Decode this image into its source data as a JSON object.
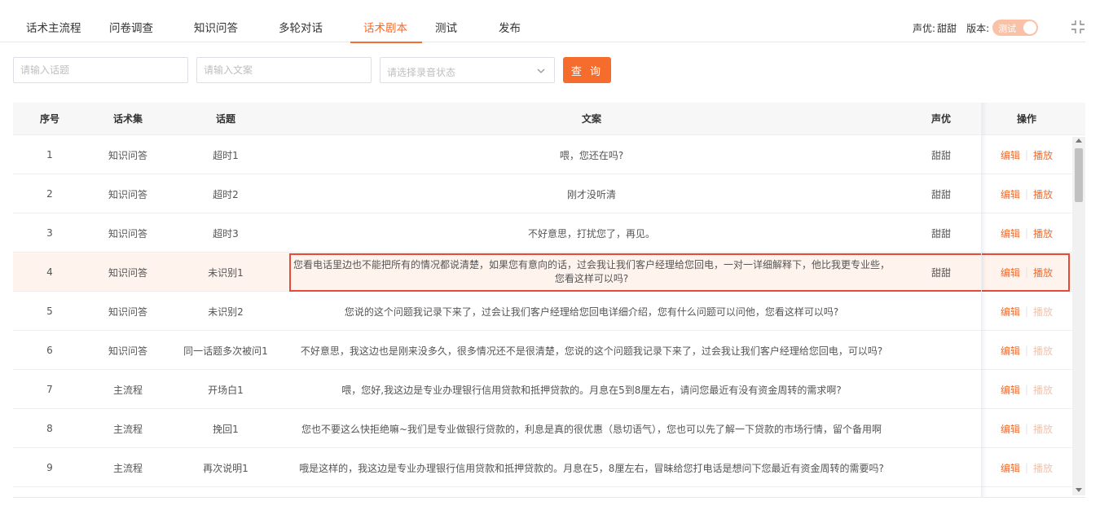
{
  "tabs": [
    {
      "label": "话术主流程",
      "active": false
    },
    {
      "label": "问卷调查",
      "active": false
    },
    {
      "label": "知识问答",
      "active": false
    },
    {
      "label": "多轮对话",
      "active": false
    },
    {
      "label": "话术剧本",
      "active": true
    },
    {
      "label": "测试",
      "active": false
    },
    {
      "label": "发布",
      "active": false
    }
  ],
  "header": {
    "voice_label": "声优:",
    "voice_value": "甜甜",
    "version_label": "版本:",
    "version_toggle": "测试"
  },
  "filters": {
    "topic_placeholder": "请输入话题",
    "text_placeholder": "请输入文案",
    "status_placeholder": "请选择录音状态",
    "query_label": "查 询"
  },
  "table": {
    "columns": [
      "序号",
      "话术集",
      "话题",
      "文案",
      "声优",
      "操作"
    ],
    "rows": [
      {
        "idx": "1",
        "set": "知识问答",
        "topic": "超时1",
        "text": "喂，您还在吗?",
        "voice": "甜甜",
        "play_enabled": true
      },
      {
        "idx": "2",
        "set": "知识问答",
        "topic": "超时2",
        "text": "刚才没听清",
        "voice": "甜甜",
        "play_enabled": true
      },
      {
        "idx": "3",
        "set": "知识问答",
        "topic": "超时3",
        "text": "不好意思，打扰您了，再见。",
        "voice": "甜甜",
        "play_enabled": true
      },
      {
        "idx": "4",
        "set": "知识问答",
        "topic": "未识别1",
        "text": "您看电话里边也不能把所有的情况都说清楚，如果您有意向的话，过会我让我们客户经理给您回电，一对一详细解释下，他比我更专业些，您看这样可以吗?",
        "voice": "甜甜",
        "play_enabled": true
      },
      {
        "idx": "5",
        "set": "知识问答",
        "topic": "未识别2",
        "text": "您说的这个问题我记录下来了，过会让我们客户经理给您回电详细介绍，您有什么问题可以问他，您看这样可以吗?",
        "voice": "",
        "play_enabled": false
      },
      {
        "idx": "6",
        "set": "知识问答",
        "topic": "同一话题多次被问1",
        "text": "不好意思，我这边也是刚来没多久，很多情况还不是很清楚，您说的这个问题我记录下来了，过会我让我们客户经理给您回电，可以吗?",
        "voice": "",
        "play_enabled": false
      },
      {
        "idx": "7",
        "set": "主流程",
        "topic": "开场白1",
        "text": "喂，您好,我这边是专业办理银行信用贷款和抵押贷款的。月息在5到8厘左右，请问您最近有没有资金周转的需求啊?",
        "voice": "",
        "play_enabled": false
      },
      {
        "idx": "8",
        "set": "主流程",
        "topic": "挽回1",
        "text": "您也不要这么快拒绝嘛~我们是专业做银行贷款的，利息是真的很优惠（恳切语气），您也可以先了解一下贷款的市场行情，留个备用啊",
        "voice": "",
        "play_enabled": false
      },
      {
        "idx": "9",
        "set": "主流程",
        "topic": "再次说明1",
        "text": "哦是这样的，我这边是专业办理银行信用贷款和抵押贷款的。月息在5，8厘左右，冒昧给您打电话是想问下您最近有资金周转的需要吗?",
        "voice": "",
        "play_enabled": false
      }
    ],
    "edit_label": "编辑",
    "play_label": "播放",
    "separator": "|"
  },
  "colors": {
    "accent": "#f56c2d",
    "disabled_link": "#f4c3aa",
    "highlight_row": "#fef3ed",
    "highlight_border": "#e64a3b"
  }
}
